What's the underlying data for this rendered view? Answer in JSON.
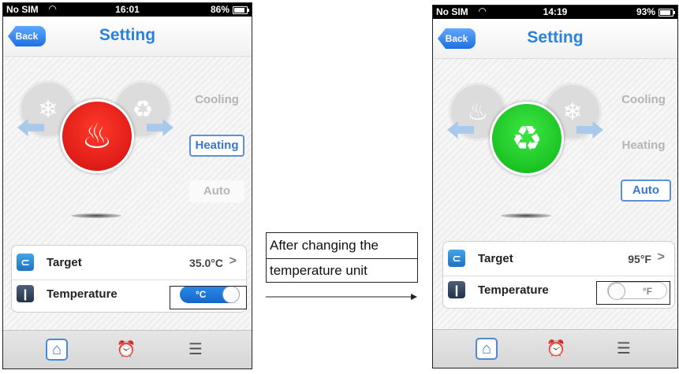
{
  "left_screen": {
    "status": {
      "carrier": "No SIM",
      "time": "16:01",
      "battery": "86%"
    },
    "nav": {
      "back_label": "Back",
      "title": "Setting"
    },
    "modes": {
      "cooling": "Cooling",
      "heating": "Heating",
      "auto": "Auto",
      "selected": "Heating"
    },
    "settings": {
      "target_label": "Target",
      "target_value": "35.0°C",
      "target_chevron": ">",
      "temperature_label": "Temperature",
      "unit_toggle": "°C",
      "unit_toggle_on": true
    }
  },
  "right_screen": {
    "status": {
      "carrier": "No SIM",
      "time": "14:19",
      "battery": "93%"
    },
    "nav": {
      "back_label": "Back",
      "title": "Setting"
    },
    "modes": {
      "cooling": "Cooling",
      "heating": "Heating",
      "auto": "Auto",
      "selected": "Auto"
    },
    "settings": {
      "target_label": "Target",
      "target_value": "95°F",
      "target_chevron": ">",
      "temperature_label": "Temperature",
      "unit_toggle": "°F",
      "unit_toggle_on": false
    }
  },
  "annotation": {
    "line1": "After changing the",
    "line2": "temperature unit"
  },
  "icons": {
    "wifi": "wifi-icon",
    "snowflake": "snowflake-icon",
    "recycle": "recycle-icon",
    "flame": "flame-icon",
    "target": "target-icon",
    "thermometer": "thermometer-icon",
    "home": "home-icon",
    "alarm": "alarm-clock-icon",
    "list": "list-icon"
  },
  "colors": {
    "accent_blue": "#2b82dc",
    "heating_red": "#e01818",
    "auto_green": "#12c41a",
    "toggle_blue": "#1f78dc"
  }
}
